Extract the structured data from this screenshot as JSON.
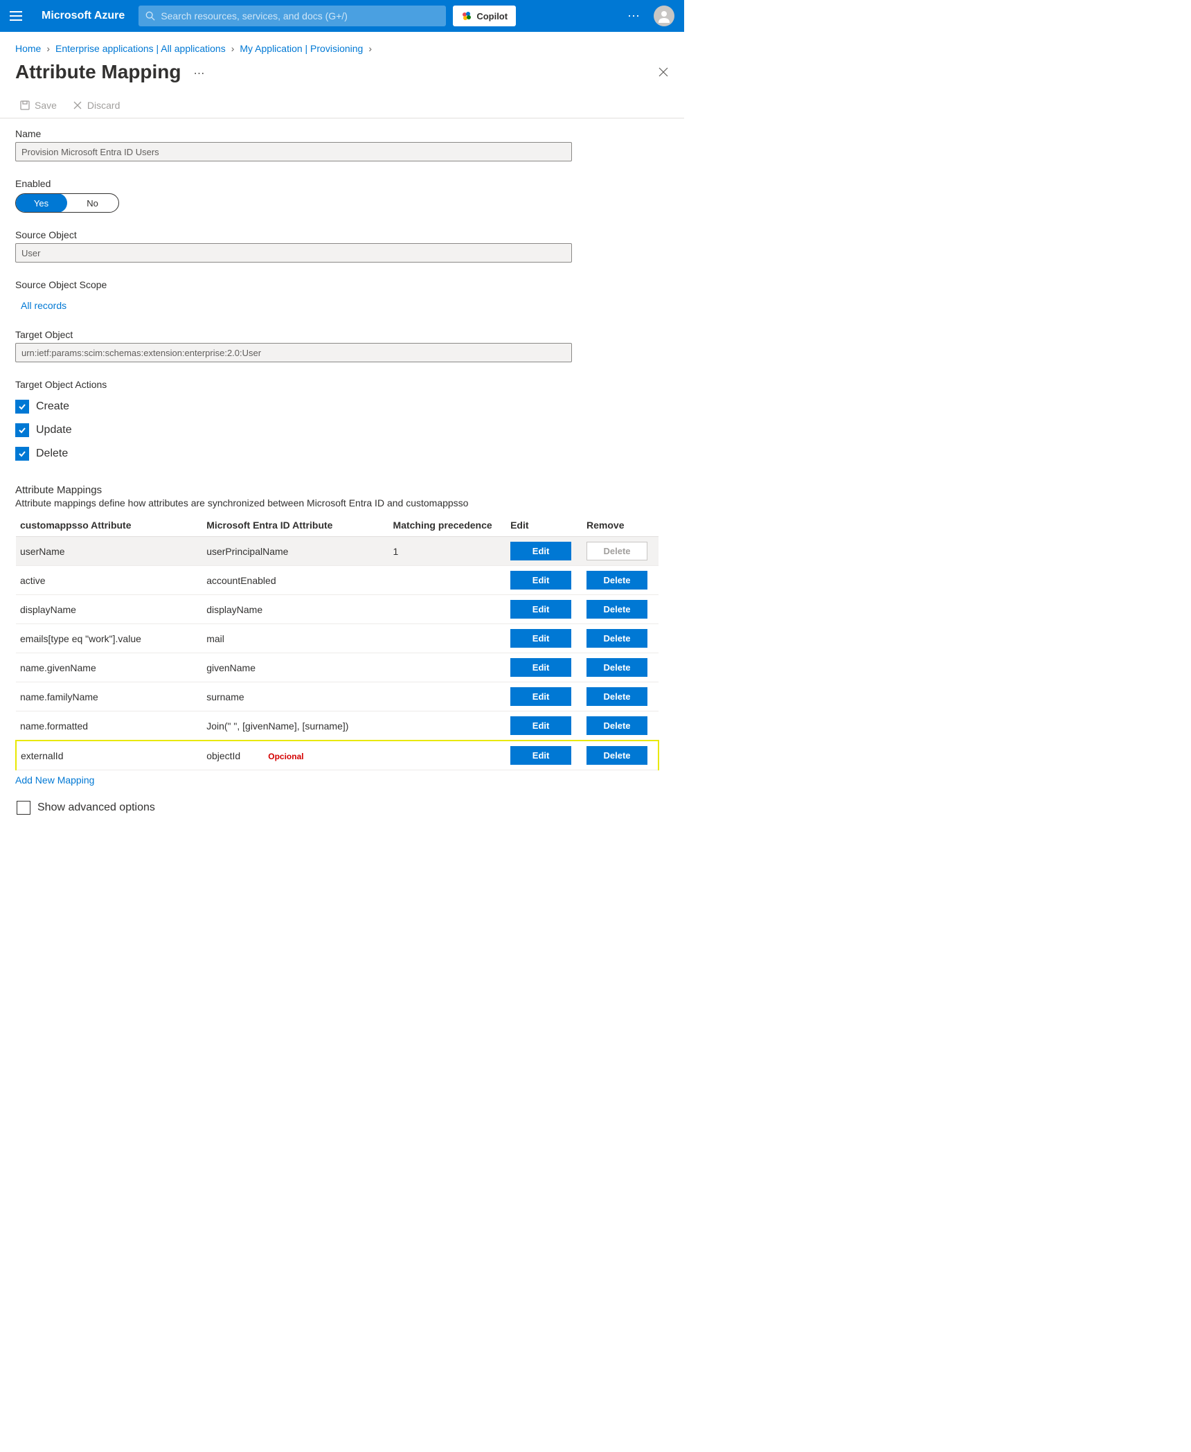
{
  "header": {
    "brand": "Microsoft Azure",
    "search_placeholder": "Search resources, services, and docs (G+/)",
    "copilot_label": "Copilot"
  },
  "breadcrumb": {
    "items": [
      "Home",
      "Enterprise applications | All applications",
      "My Application | Provisioning"
    ]
  },
  "page": {
    "title": "Attribute Mapping"
  },
  "toolbar": {
    "save_label": "Save",
    "discard_label": "Discard"
  },
  "form": {
    "name_label": "Name",
    "name_value": "Provision Microsoft Entra ID Users",
    "enabled_label": "Enabled",
    "enabled_yes": "Yes",
    "enabled_no": "No",
    "source_object_label": "Source Object",
    "source_object_value": "User",
    "source_scope_label": "Source Object Scope",
    "source_scope_link": "All records",
    "target_object_label": "Target Object",
    "target_object_value": "urn:ietf:params:scim:schemas:extension:enterprise:2.0:User",
    "target_actions_label": "Target Object Actions",
    "actions": {
      "create": "Create",
      "update": "Update",
      "delete": "Delete"
    }
  },
  "mappings": {
    "section_title": "Attribute Mappings",
    "section_desc": "Attribute mappings define how attributes are synchronized between Microsoft Entra ID and customappsso",
    "columns": {
      "c1": "customappsso Attribute",
      "c2": "Microsoft Entra ID Attribute",
      "c3": "Matching precedence",
      "c4": "Edit",
      "c5": "Remove"
    },
    "edit_label": "Edit",
    "delete_label": "Delete",
    "opcional_label": "Opcional",
    "rows": [
      {
        "target": "userName",
        "source": "userPrincipalName",
        "prec": "1",
        "delete_disabled": true,
        "highlight": false,
        "hover": true
      },
      {
        "target": "active",
        "source": "accountEnabled",
        "prec": "",
        "delete_disabled": false,
        "highlight": false
      },
      {
        "target": "displayName",
        "source": "displayName",
        "prec": "",
        "delete_disabled": false,
        "highlight": false
      },
      {
        "target": "emails[type eq \"work\"].value",
        "source": "mail",
        "prec": "",
        "delete_disabled": false,
        "highlight": false
      },
      {
        "target": "name.givenName",
        "source": "givenName",
        "prec": "",
        "delete_disabled": false,
        "highlight": false
      },
      {
        "target": "name.familyName",
        "source": "surname",
        "prec": "",
        "delete_disabled": false,
        "highlight": false
      },
      {
        "target": "name.formatted",
        "source": "Join(\" \", [givenName], [surname])",
        "prec": "",
        "delete_disabled": false,
        "highlight": false
      },
      {
        "target": "externalId",
        "source": "objectId",
        "prec": "",
        "delete_disabled": false,
        "highlight": true,
        "opcional": true
      }
    ],
    "add_new": "Add New Mapping",
    "show_advanced": "Show advanced options"
  }
}
